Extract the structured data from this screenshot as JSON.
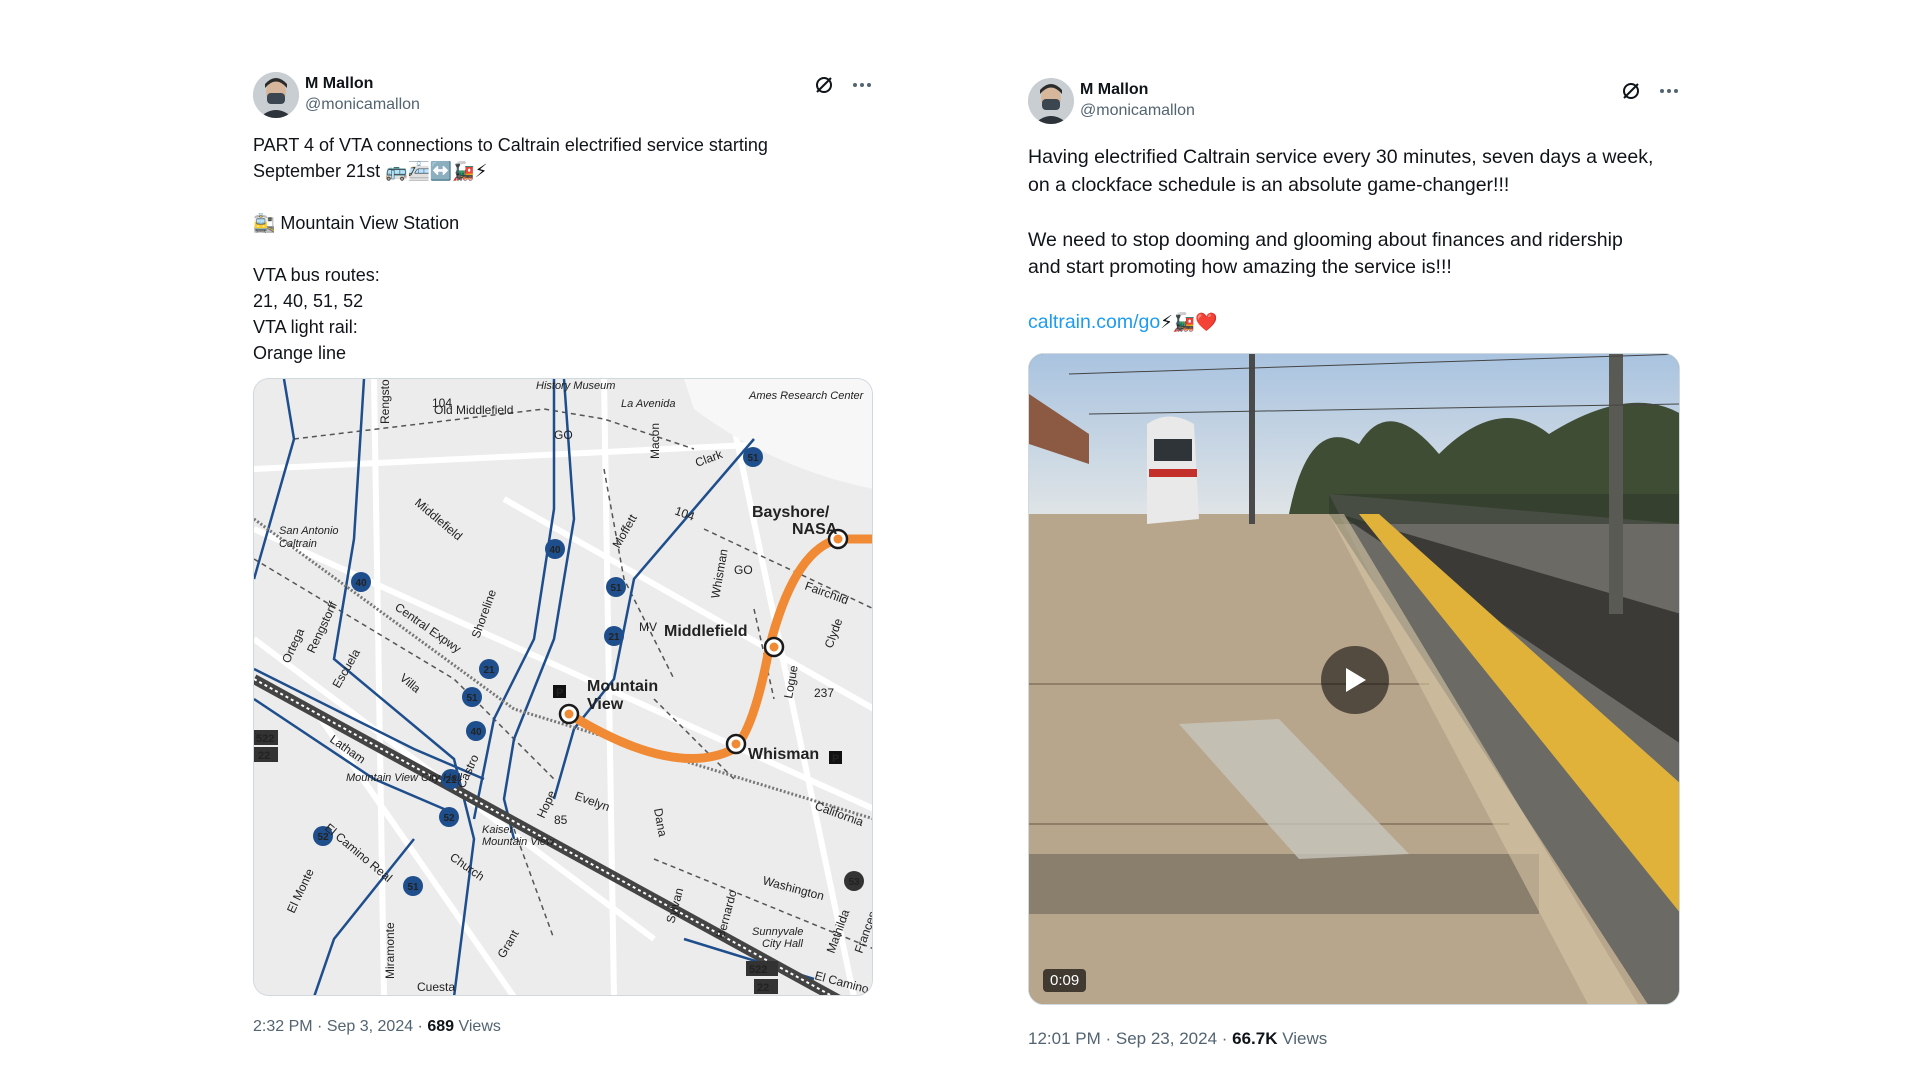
{
  "tweets": [
    {
      "author_name": "M Mallon",
      "handle": "@monicamallon",
      "text_lines": [
        "PART 4 of VTA connections to Caltrain electrified service starting",
        "September 21st 🚌🚈↔️🚂⚡",
        "",
        "🚉 Mountain View Station",
        "",
        "VTA bus routes:",
        "21, 40, 51, 52",
        "VTA light rail:",
        "Orange line"
      ],
      "time": "2:32 PM",
      "date": "Sep 3, 2024",
      "views_count": "689",
      "views_label": "Views",
      "map": {
        "labels": {
          "history_museum": "History Museum",
          "la_avenida": "La Avenida",
          "ames": "Ames Research Center",
          "old_middlefield": "Old Middlefield",
          "rengstorff_top": "Rengstorff",
          "bayshore": "Bayshore/",
          "nasa": "NASA",
          "middlefield_station": "Middlefield",
          "mountain_view_1": "Mountain",
          "mountain_view_2": "View",
          "whisman_station": "Whisman",
          "san_antonio_1": "San Antonio",
          "san_antonio_2": "Caltrain",
          "central_expwy": "Central Expwy",
          "middlefield_road": "Middlefield",
          "moffett": "Moffett",
          "shoreline": "Shoreline",
          "fairchild": "Fairchild",
          "clyde": "Clyde",
          "logue": "Logue",
          "evelyn": "Evelyn",
          "california": "California",
          "castro": "Castro",
          "hope": "Hope",
          "escuela": "Escuela",
          "villa": "Villa",
          "latham": "Latham",
          "el_camino": "El Camino Real",
          "el_monte": "El Monte",
          "church": "Church",
          "view": "View",
          "city_hall": "Mountain View City Hall",
          "kaiser_1": "Kaiser",
          "kaiser_2": "Mountain View",
          "washington": "Washington",
          "sunnyvale_1": "Sunnyvale",
          "sunnyvale_2": "City Hall",
          "mathilda": "Mathilda",
          "frances": "Frances",
          "bernardo": "Bernardo",
          "sylvan": "Sylvan",
          "dana": "Dana",
          "grant": "Grant",
          "miramonte": "Miramonte",
          "cuesta": "Cuesta",
          "clark": "Clark",
          "ortega": "Ortega",
          "rengstorff": "Rengstorff",
          "macon": "Macon",
          "whisman_road": "Whisman",
          "route_104": "104",
          "route_21": "21",
          "route_40": "40",
          "route_51": "51",
          "route_52": "52",
          "route_53": "53",
          "route_522": "522",
          "route_22": "22",
          "go": "GO",
          "mv": "MV",
          "shield_85": "85",
          "shield_237": "237",
          "p_sign": "P",
          "el_camino_right": "El Camino"
        }
      }
    },
    {
      "author_name": "M Mallon",
      "handle": "@monicamallon",
      "para1_lines": [
        "Having electrified Caltrain service every 30 minutes, seven days a week,",
        "on a clockface schedule is an absolute game-changer!!!"
      ],
      "para2_lines": [
        "We need to stop dooming and glooming about finances and ridership",
        "and start promoting how amazing the service is!!!"
      ],
      "link_text": "caltrain.com/go",
      "link_emoji": "⚡🚂❤️",
      "video_duration": "0:09",
      "time": "12:01 PM",
      "date": "Sep 23, 2024",
      "views_count": "66.7K",
      "views_label": "Views"
    }
  ],
  "icons": [
    "grok-icon",
    "more-icon",
    "play-icon"
  ],
  "colors": {
    "accent": "#1d9bf0",
    "orange_line": "#f08a35",
    "bus_route": "#1f4e8c",
    "caltrain_track": "#444444"
  }
}
